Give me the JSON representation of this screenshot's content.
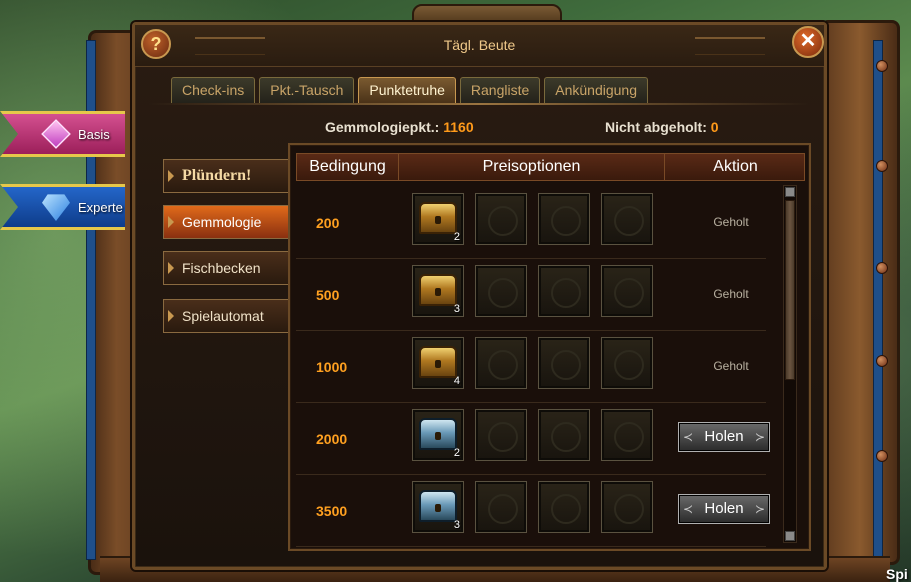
{
  "window": {
    "title": "Tägl. Beute"
  },
  "side_tabs": [
    {
      "label": "Basis",
      "icon": "pink-gem-icon"
    },
    {
      "label": "Experte",
      "icon": "blue-diamond-icon"
    }
  ],
  "tabs": [
    {
      "label": "Check-ins",
      "active": false
    },
    {
      "label": "Pkt.-Tausch",
      "active": false
    },
    {
      "label": "Punktetruhe",
      "active": true
    },
    {
      "label": "Rangliste",
      "active": false
    },
    {
      "label": "Ankündigung",
      "active": false
    }
  ],
  "info": {
    "points_label": "Gemmologiepkt.:",
    "points_value": "1160",
    "unclaimed_label": "Nicht abgeholt:",
    "unclaimed_value": "0"
  },
  "menu": [
    {
      "label": "Plündern!"
    },
    {
      "label": "Gemmologie",
      "active": true
    },
    {
      "label": "Fischbecken"
    },
    {
      "label": "Spielautomat"
    }
  ],
  "table": {
    "headers": {
      "condition": "Bedingung",
      "rewards": "Preisoptionen",
      "action": "Aktion"
    },
    "rows": [
      {
        "condition": "200",
        "chest": "gold",
        "qty": "2",
        "status": "Geholt",
        "claimable": false
      },
      {
        "condition": "500",
        "chest": "gold",
        "qty": "3",
        "status": "Geholt",
        "claimable": false
      },
      {
        "condition": "1000",
        "chest": "gold",
        "qty": "4",
        "status": "Geholt",
        "claimable": false
      },
      {
        "condition": "2000",
        "chest": "silver",
        "qty": "2",
        "status": "Holen",
        "claimable": true
      },
      {
        "condition": "3500",
        "chest": "silver",
        "qty": "3",
        "status": "Holen",
        "claimable": true
      }
    ]
  },
  "corner_text": "Spi",
  "colors": {
    "accent_orange": "#ff9a1a",
    "title_gold": "#f0c98a"
  }
}
